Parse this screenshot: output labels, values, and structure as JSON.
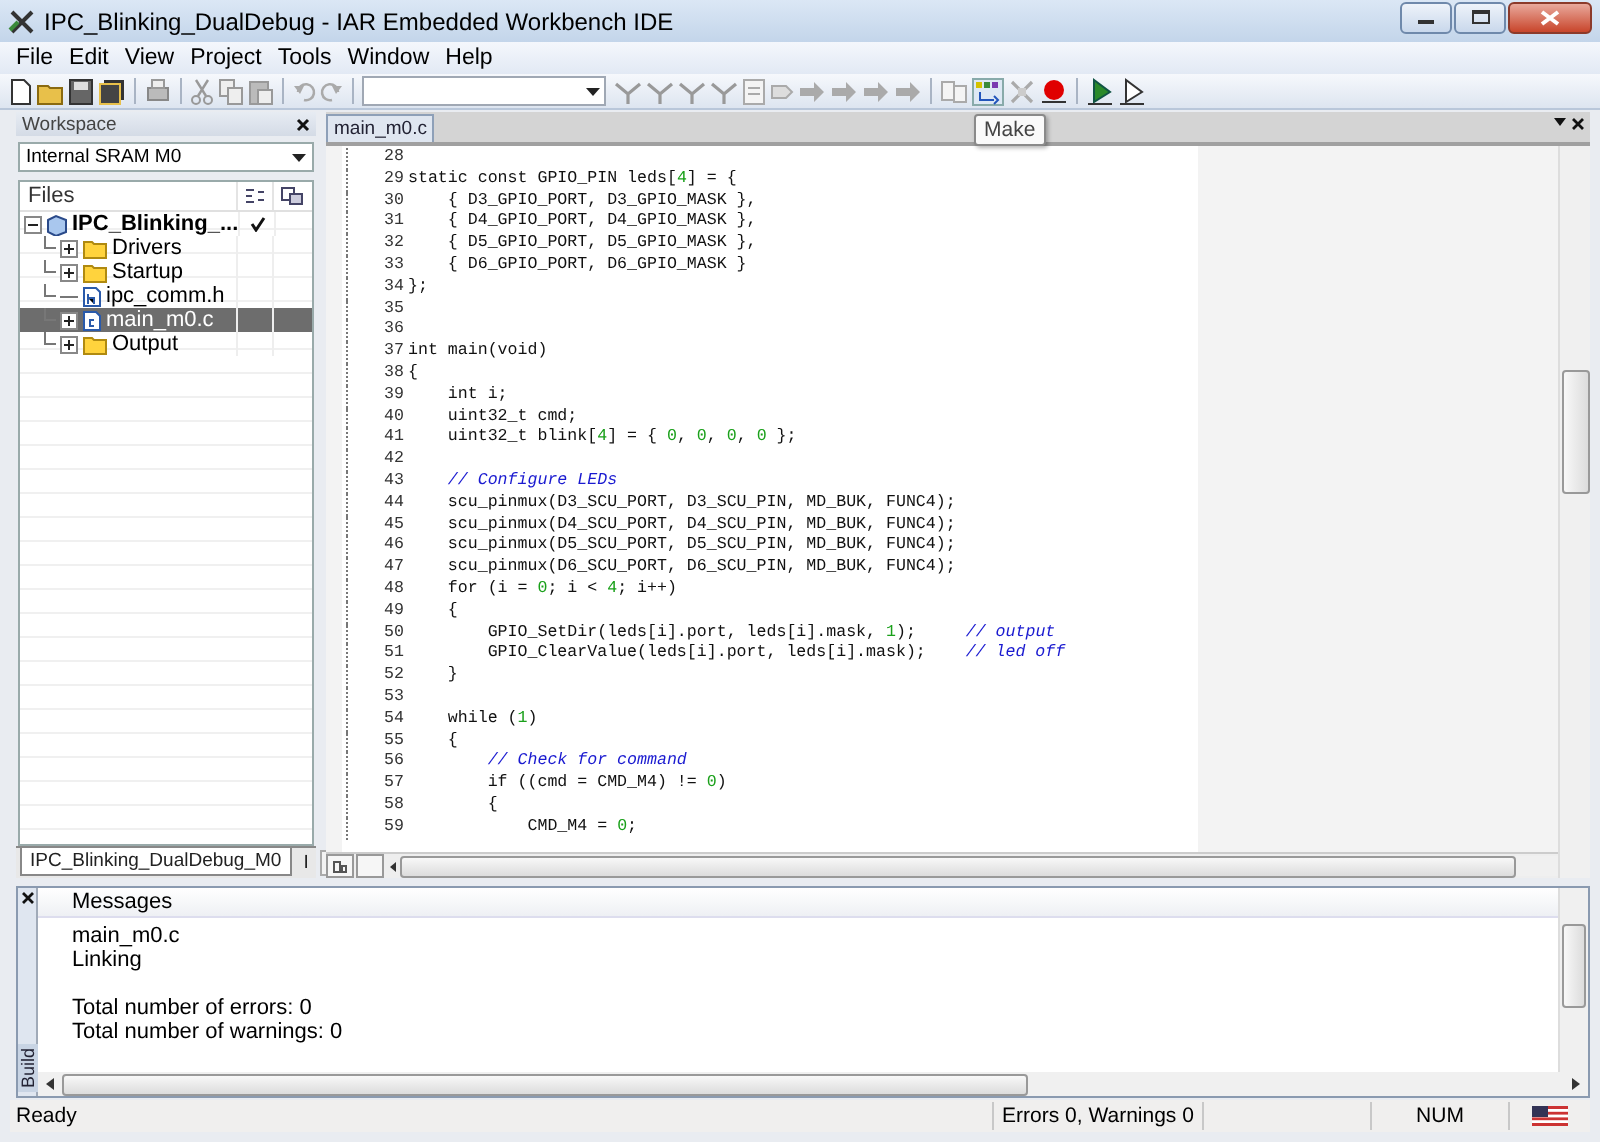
{
  "window": {
    "title": "IPC_Blinking_DualDebug - IAR Embedded Workbench IDE"
  },
  "menu": [
    "File",
    "Edit",
    "View",
    "Project",
    "Tools",
    "Window",
    "Help"
  ],
  "toolbar": {
    "tooltip": "Make"
  },
  "workspace": {
    "title": "Workspace",
    "configuration": "Internal SRAM M0",
    "column": "Files",
    "tree": [
      {
        "label": "IPC_Blinking_...",
        "kind": "project",
        "expanded": true,
        "selected": false,
        "checked": true,
        "children": [
          {
            "label": "Drivers",
            "kind": "folder",
            "expanded": false,
            "selected": false,
            "checked": false
          },
          {
            "label": "Startup",
            "kind": "folder",
            "expanded": false,
            "selected": false,
            "checked": false
          },
          {
            "label": "ipc_comm.h",
            "kind": "header",
            "selected": false,
            "checked": false
          },
          {
            "label": "main_m0.c",
            "kind": "source",
            "expanded": false,
            "selected": true,
            "checked": false
          },
          {
            "label": "Output",
            "kind": "folder",
            "expanded": false,
            "selected": false,
            "checked": false
          }
        ]
      }
    ],
    "tabs": [
      {
        "label": "IPC_Blinking_DualDebug_M0",
        "selected": true
      },
      {
        "label": "I",
        "selected": false
      }
    ]
  },
  "editor": {
    "tab": "main_m0.c",
    "lines": [
      {
        "number": "28"
      },
      {
        "number": "29",
        "segments": [
          {
            "kind": "code",
            "text": "static const GPIO_PIN leds["
          },
          {
            "kind": "number",
            "text": "4"
          },
          {
            "kind": "code",
            "text": "] = {"
          }
        ]
      },
      {
        "number": "30",
        "segments": [
          {
            "kind": "code",
            "text": "    { D3_GPIO_PORT, D3_GPIO_MASK },"
          }
        ]
      },
      {
        "number": "31",
        "segments": [
          {
            "kind": "code",
            "text": "    { D4_GPIO_PORT, D4_GPIO_MASK },"
          }
        ]
      },
      {
        "number": "32",
        "segments": [
          {
            "kind": "code",
            "text": "    { D5_GPIO_PORT, D5_GPIO_MASK },"
          }
        ]
      },
      {
        "number": "33",
        "segments": [
          {
            "kind": "code",
            "text": "    { D6_GPIO_PORT, D6_GPIO_MASK }"
          }
        ]
      },
      {
        "number": "34",
        "segments": [
          {
            "kind": "code",
            "text": "};"
          }
        ]
      },
      {
        "number": "35"
      },
      {
        "number": "36"
      },
      {
        "number": "37",
        "segments": [
          {
            "kind": "code",
            "text": "int main(void)"
          }
        ]
      },
      {
        "number": "38",
        "segments": [
          {
            "kind": "code",
            "text": "{"
          }
        ]
      },
      {
        "number": "39",
        "segments": [
          {
            "kind": "code",
            "text": "    int i;"
          }
        ]
      },
      {
        "number": "40",
        "segments": [
          {
            "kind": "code",
            "text": "    uint32_t cmd;"
          }
        ]
      },
      {
        "number": "41",
        "segments": [
          {
            "kind": "code",
            "text": "    uint32_t blink["
          },
          {
            "kind": "number",
            "text": "4"
          },
          {
            "kind": "code",
            "text": "] = { "
          },
          {
            "kind": "number",
            "text": "0"
          },
          {
            "kind": "code",
            "text": ", "
          },
          {
            "kind": "number",
            "text": "0"
          },
          {
            "kind": "code",
            "text": ", "
          },
          {
            "kind": "number",
            "text": "0"
          },
          {
            "kind": "code",
            "text": ", "
          },
          {
            "kind": "number",
            "text": "0"
          },
          {
            "kind": "code",
            "text": " };"
          }
        ]
      },
      {
        "number": "42"
      },
      {
        "number": "43",
        "segments": [
          {
            "kind": "comment",
            "text": "    // Configure LEDs"
          }
        ]
      },
      {
        "number": "44",
        "segments": [
          {
            "kind": "code",
            "text": "    scu_pinmux(D3_SCU_PORT, D3_SCU_PIN, MD_BUK, FUNC4);"
          }
        ]
      },
      {
        "number": "45",
        "segments": [
          {
            "kind": "code",
            "text": "    scu_pinmux(D4_SCU_PORT, D4_SCU_PIN, MD_BUK, FUNC4);"
          }
        ]
      },
      {
        "number": "46",
        "segments": [
          {
            "kind": "code",
            "text": "    scu_pinmux(D5_SCU_PORT, D5_SCU_PIN, MD_BUK, FUNC4);"
          }
        ]
      },
      {
        "number": "47",
        "segments": [
          {
            "kind": "code",
            "text": "    scu_pinmux(D6_SCU_PORT, D6_SCU_PIN, MD_BUK, FUNC4);"
          }
        ]
      },
      {
        "number": "48",
        "segments": [
          {
            "kind": "code",
            "text": "    for (i = "
          },
          {
            "kind": "number",
            "text": "0"
          },
          {
            "kind": "code",
            "text": "; i < "
          },
          {
            "kind": "number",
            "text": "4"
          },
          {
            "kind": "code",
            "text": "; i++)"
          }
        ]
      },
      {
        "number": "49",
        "segments": [
          {
            "kind": "code",
            "text": "    {"
          }
        ]
      },
      {
        "number": "50",
        "segments": [
          {
            "kind": "code",
            "text": "        GPIO_SetDir(leds[i].port, leds[i].mask, "
          },
          {
            "kind": "number",
            "text": "1"
          },
          {
            "kind": "code",
            "text": ");     "
          },
          {
            "kind": "comment",
            "text": "// output"
          }
        ]
      },
      {
        "number": "51",
        "segments": [
          {
            "kind": "code",
            "text": "        GPIO_ClearValue(leds[i].port, leds[i].mask);    "
          },
          {
            "kind": "comment",
            "text": "// led off"
          }
        ]
      },
      {
        "number": "52",
        "segments": [
          {
            "kind": "code",
            "text": "    }"
          }
        ]
      },
      {
        "number": "53"
      },
      {
        "number": "54",
        "segments": [
          {
            "kind": "code",
            "text": "    while ("
          },
          {
            "kind": "number",
            "text": "1"
          },
          {
            "kind": "code",
            "text": ")"
          }
        ]
      },
      {
        "number": "55",
        "segments": [
          {
            "kind": "code",
            "text": "    {"
          }
        ]
      },
      {
        "number": "56",
        "segments": [
          {
            "kind": "comment",
            "text": "        // Check for command"
          }
        ]
      },
      {
        "number": "57",
        "segments": [
          {
            "kind": "code",
            "text": "        if ((cmd = CMD_M4) != "
          },
          {
            "kind": "number",
            "text": "0"
          },
          {
            "kind": "code",
            "text": ")"
          }
        ]
      },
      {
        "number": "58",
        "segments": [
          {
            "kind": "code",
            "text": "        {"
          }
        ]
      },
      {
        "number": "59",
        "segments": [
          {
            "kind": "code",
            "text": "            CMD_M4 = "
          },
          {
            "kind": "number",
            "text": "0"
          },
          {
            "kind": "code",
            "text": ";"
          }
        ]
      }
    ]
  },
  "build": {
    "tab": "Build",
    "header": "Messages",
    "message_groups": [
      [
        "main_m0.c",
        "Linking"
      ],
      [
        "Total number of errors: 0",
        "Total number of warnings: 0"
      ]
    ]
  },
  "status_bar": {
    "text": "Ready",
    "errors": "Errors 0, Warnings 0",
    "num": "NUM"
  }
}
